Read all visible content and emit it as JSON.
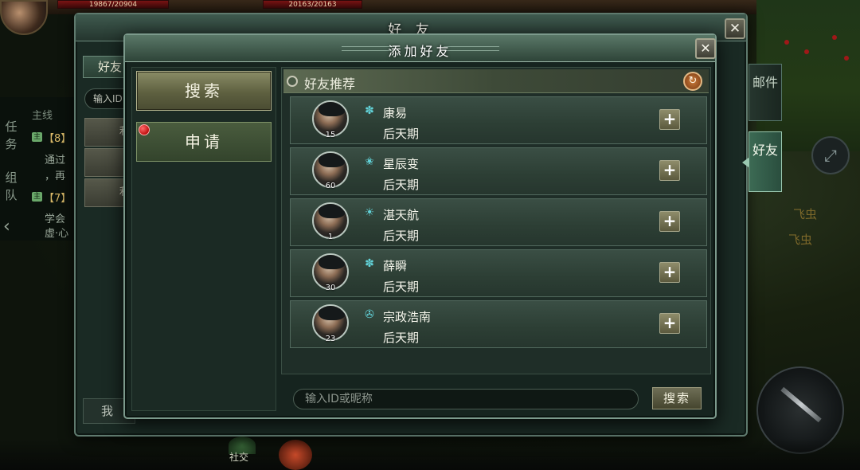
{
  "hud": {
    "hp_left": "19867/20904",
    "hp_right": "20163/20163",
    "tasks_tab": "任务",
    "team_tab": "组队",
    "mainline": "主线",
    "quest1_tag": "主",
    "quest1_title": "【8】",
    "quest1_line1": "通过",
    "quest1_line2": "，再",
    "quest2_tag": "主",
    "quest2_title": "【7】",
    "quest2_line1": "学会",
    "quest2_line2": "虚·心",
    "floating_text1": "飞虫",
    "floating_text2": "飞虫",
    "social_label": "社交"
  },
  "friend_window": {
    "title": "好 友",
    "close_icon": "close-icon",
    "tab_label": "好友",
    "input_text": "输入ID",
    "list_buttons": [
      "利",
      "1",
      "利"
    ],
    "bottom_button": "我"
  },
  "side_tabs": {
    "mail": "邮件",
    "friend": "好友"
  },
  "dialog": {
    "title": "添加好友",
    "close_icon": "close-icon",
    "nav": {
      "search": "搜索",
      "apply": "申请"
    },
    "recommend_title": "好友推荐",
    "refresh_icon": "refresh-icon",
    "add_icon": "plus-icon",
    "friends": [
      {
        "name": "康易",
        "rank": "后天期",
        "level": "15",
        "class_icon": "lotus-icon",
        "class_glyph": "✽"
      },
      {
        "name": "星辰变",
        "rank": "后天期",
        "level": "60",
        "class_icon": "star-icon",
        "class_glyph": "✬"
      },
      {
        "name": "湛天航",
        "rank": "后天期",
        "level": "1",
        "class_icon": "sun-icon",
        "class_glyph": "☀"
      },
      {
        "name": "薛瞬",
        "rank": "后天期",
        "level": "30",
        "class_icon": "lotus-icon",
        "class_glyph": "✽"
      },
      {
        "name": "宗政浩南",
        "rank": "后天期",
        "level": "23",
        "class_icon": "swirl-icon",
        "class_glyph": "✇"
      }
    ],
    "search_placeholder": "输入ID或昵称",
    "search_button": "搜索"
  }
}
